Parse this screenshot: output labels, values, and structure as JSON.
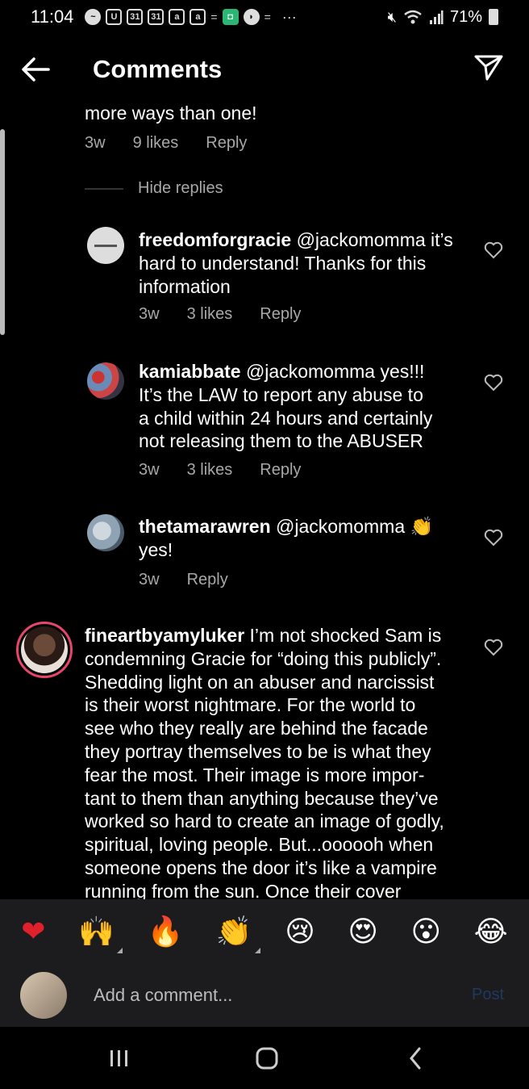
{
  "status_bar": {
    "time": "11:04",
    "battery": "71%",
    "icons": [
      "messenger-icon",
      "u-app-icon",
      "calendar-31-icon",
      "calendar-31-icon",
      "a-app-icon",
      "a-app-icon",
      "minus-icon",
      "green-app-icon",
      "chat-icon",
      "minus-icon",
      "more-dots-icon",
      "mute-icon",
      "wifi-icon",
      "signal-icon",
      "battery-icon"
    ],
    "more": "···"
  },
  "header": {
    "title": "Comments"
  },
  "comments": {
    "top": {
      "text_tail": "more ways than one!",
      "age": "3w",
      "likes": "9 likes",
      "reply": "Reply"
    },
    "hide_replies": "Hide replies",
    "replies": [
      {
        "username": "freedomforgracie",
        "line1": "@jackomomma it’s",
        "line2": "hard to understand! Thanks for this",
        "line3": "information",
        "age": "3w",
        "likes": "3 likes",
        "reply": "Reply"
      },
      {
        "username": "kamiabbate",
        "line1": "@jackomomma yes!!!",
        "line2": "It’s the LAW to report any abuse to",
        "line3": "a child within 24 hours and certainly",
        "line4": "not releasing them to the ABUSER",
        "age": "3w",
        "likes": "3 likes",
        "reply": "Reply"
      },
      {
        "username": "thetamarawren",
        "line1": "@jackomomma 👏",
        "line2": "yes!",
        "age": "3w",
        "reply": "Reply"
      }
    ],
    "main": {
      "username": "fineartbyamyluker",
      "lines": [
        "I’m not shocked Sam is",
        "condemning Gracie for “doing this publicly”.",
        "Shedding light on an abuser and narcissist",
        "is their worst nightmare. For the world to",
        "see who they really are behind the facade",
        "they portray themselves to be is what they",
        "fear the most. Their image is more impor-",
        "tant to them than anything because they’ve",
        "worked so hard to create an image of godly,",
        "spiritual, loving people. But...oooooh when",
        "someone opens the door it’s like a vampire",
        "running from the sun. Once their cover"
      ]
    }
  },
  "reactions": [
    "❤",
    "🙌",
    "🔥",
    "👏",
    "😢",
    "😍",
    "😮",
    "😂"
  ],
  "composer": {
    "placeholder": "Add a comment...",
    "post": "Post"
  },
  "colors": {
    "background": "#000000",
    "secondary_text": "#a8a8a8",
    "reaction_bar": "#1c1c1e"
  }
}
